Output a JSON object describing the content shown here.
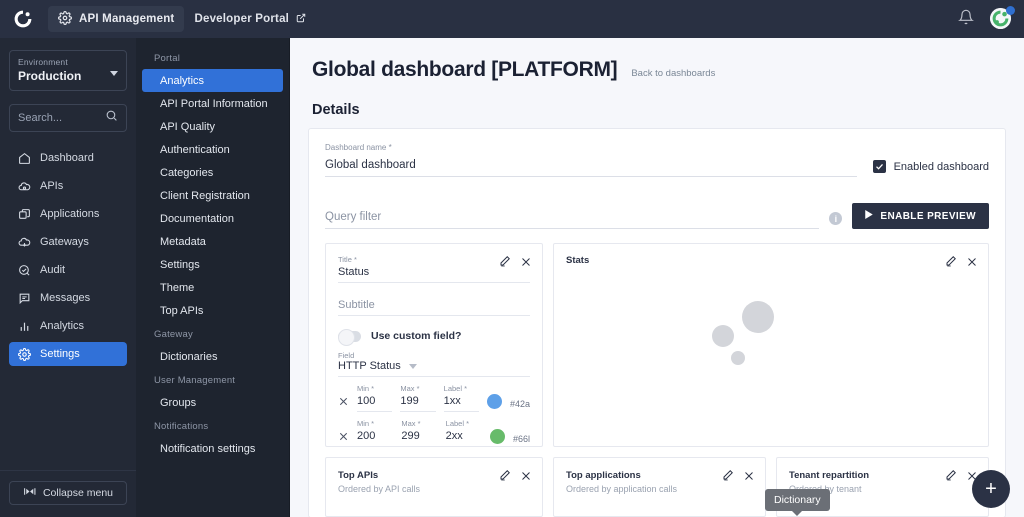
{
  "topbar": {
    "logo_icon": "gravitee-logo-icon",
    "app_nav": {
      "label": "API Management",
      "icon": "gear-icon"
    },
    "developer_portal": {
      "label": "Developer Portal",
      "icon": "external-link-icon"
    },
    "notifications_icon": "bell-icon",
    "avatar_icon": "user-avatar"
  },
  "leftnav": {
    "environment": {
      "label": "Environment",
      "value": "Production",
      "caret_icon": "chevron-down-icon"
    },
    "search": {
      "placeholder": "Search...",
      "value": "",
      "icon": "search-icon"
    },
    "items": [
      {
        "label": "Dashboard",
        "icon": "home-icon",
        "active": false
      },
      {
        "label": "APIs",
        "icon": "api-cloud-icon",
        "active": false
      },
      {
        "label": "Applications",
        "icon": "applications-icon",
        "active": false
      },
      {
        "label": "Gateways",
        "icon": "gateway-cloud-icon",
        "active": false
      },
      {
        "label": "Audit",
        "icon": "audit-check-icon",
        "active": false
      },
      {
        "label": "Messages",
        "icon": "messages-icon",
        "active": false
      },
      {
        "label": "Analytics",
        "icon": "analytics-bars-icon",
        "active": false
      },
      {
        "label": "Settings",
        "icon": "gear-icon",
        "active": true
      }
    ],
    "collapse": {
      "label": "Collapse menu",
      "icon": "collapse-icon"
    }
  },
  "subnav": {
    "groups": [
      {
        "title": "Portal",
        "items": [
          {
            "label": "Analytics",
            "active": true
          },
          {
            "label": "API Portal Information",
            "active": false
          },
          {
            "label": "API Quality",
            "active": false
          },
          {
            "label": "Authentication",
            "active": false
          },
          {
            "label": "Categories",
            "active": false
          },
          {
            "label": "Client Registration",
            "active": false
          },
          {
            "label": "Documentation",
            "active": false
          },
          {
            "label": "Metadata",
            "active": false
          },
          {
            "label": "Settings",
            "active": false
          },
          {
            "label": "Theme",
            "active": false
          },
          {
            "label": "Top APIs",
            "active": false
          }
        ]
      },
      {
        "title": "Gateway",
        "items": [
          {
            "label": "Dictionaries",
            "active": false
          }
        ]
      },
      {
        "title": "User Management",
        "items": [
          {
            "label": "Groups",
            "active": false
          }
        ]
      },
      {
        "title": "Notifications",
        "items": [
          {
            "label": "Notification settings",
            "active": false
          }
        ]
      }
    ]
  },
  "page": {
    "title": "Global dashboard [PLATFORM]",
    "back_link": "Back to dashboards",
    "section_title": "Details"
  },
  "details": {
    "dashboard_name": {
      "label": "Dashboard name *",
      "value": "Global dashboard"
    },
    "enabled": {
      "label": "Enabled dashboard",
      "checked": true,
      "check_icon": "check-icon"
    },
    "query_filter": {
      "placeholder": "Query filter",
      "value": "",
      "info_icon": "info-icon"
    },
    "enable_preview": {
      "label": "ENABLE PREVIEW",
      "icon": "play-icon"
    }
  },
  "widgets": {
    "status": {
      "title_label": "Title *",
      "title_value": "Status",
      "subtitle_placeholder": "Subtitle",
      "custom_field": {
        "label": "Use custom field?",
        "enabled": false
      },
      "field_label": "Field",
      "field_value": "HTTP Status",
      "edit_icon": "pencil-icon",
      "close_icon": "close-icon",
      "columns": {
        "min": "Min *",
        "max": "Max *",
        "label": "Label *"
      },
      "rows": [
        {
          "min": "100",
          "max": "199",
          "label": "1xx",
          "color": "#5ea0e8",
          "hex": "#42a"
        },
        {
          "min": "200",
          "max": "299",
          "label": "2xx",
          "color": "#67bb6a",
          "hex": "#66l"
        },
        {
          "min": "",
          "max": "",
          "label": "",
          "color": "",
          "hex": ""
        }
      ]
    },
    "stats": {
      "title": "Stats",
      "edit_icon": "pencil-icon",
      "close_icon": "close-icon"
    },
    "bottom": [
      {
        "title": "Top APIs",
        "subtitle": "Ordered by API calls",
        "edit_icon": "pencil-icon",
        "close_icon": "close-icon"
      },
      {
        "title": "Top applications",
        "subtitle": "Ordered by application calls",
        "edit_icon": "pencil-icon",
        "close_icon": "close-icon"
      },
      {
        "title": "Tenant repartition",
        "subtitle": "Ordered by tenant",
        "edit_icon": "pencil-icon",
        "close_icon": "close-icon"
      }
    ]
  },
  "tooltip": {
    "text": "Dictionary"
  },
  "fab": {
    "label": "+"
  },
  "chart_data": {
    "type": "scatter",
    "title": "Stats",
    "bubbles": [
      {
        "cx": 0.47,
        "cy": 0.42,
        "r": 16,
        "color": "#d3d5da"
      },
      {
        "cx": 0.39,
        "cy": 0.55,
        "r": 11,
        "color": "#d3d5da"
      },
      {
        "cx": 0.42,
        "cy": 0.7,
        "r": 7,
        "color": "#d3d5da"
      }
    ],
    "xlabel": "",
    "ylabel": "",
    "grid": false,
    "legend": false
  }
}
